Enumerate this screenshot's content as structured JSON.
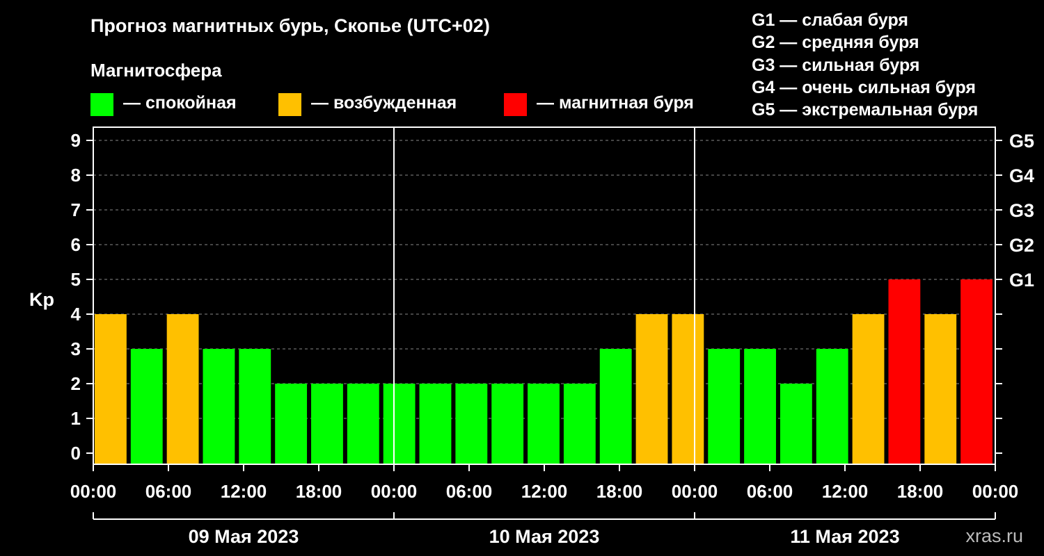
{
  "header": {
    "title": "Прогноз магнитных бурь, Скопье (UTC+02)",
    "subtitle": "Магнитосфера"
  },
  "legend": {
    "items": [
      {
        "label": "— спокойная",
        "color": "#00ff00"
      },
      {
        "label": "— возбужденная",
        "color": "#ffc000"
      },
      {
        "label": "— магнитная буря",
        "color": "#ff0000"
      }
    ]
  },
  "g_scale": [
    "G1 — слабая буря",
    "G2 — средняя буря",
    "G3 — сильная буря",
    "G4 — очень сильная буря",
    "G5 — экстремальная буря"
  ],
  "watermark": "xras.ru",
  "chart_data": {
    "type": "bar",
    "ylabel": "Kp",
    "ylim": [
      0,
      9
    ],
    "yticks": [
      "0",
      "1",
      "2",
      "3",
      "4",
      "5",
      "6",
      "7",
      "8",
      "9"
    ],
    "right_ticks": [
      {
        "value": 5,
        "label": "G1"
      },
      {
        "value": 6,
        "label": "G2"
      },
      {
        "value": 7,
        "label": "G3"
      },
      {
        "value": 8,
        "label": "G4"
      },
      {
        "value": 9,
        "label": "G5"
      }
    ],
    "xticks": [
      "00:00",
      "06:00",
      "12:00",
      "18:00",
      "00:00",
      "06:00",
      "12:00",
      "18:00",
      "00:00",
      "06:00",
      "12:00",
      "18:00",
      "00:00"
    ],
    "days": [
      "09 Мая 2023",
      "10 Мая 2023",
      "11 Мая 2023"
    ],
    "interval_hours": 3,
    "values": [
      4,
      3,
      4,
      3,
      3,
      2,
      2,
      2,
      2,
      2,
      2,
      2,
      2,
      2,
      3,
      4,
      4,
      3,
      3,
      2,
      3,
      4,
      5,
      4,
      5
    ],
    "colors": {
      "calm": "#00ff00",
      "excited": "#ffc000",
      "storm": "#ff0000"
    },
    "grid": true
  }
}
